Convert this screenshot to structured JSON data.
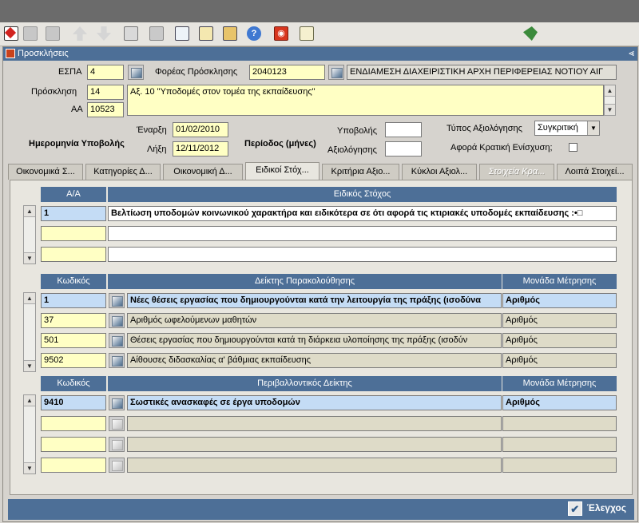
{
  "toolbar": {
    "icons": [
      "check-cursor-icon",
      "grid-icon",
      "grid-icon",
      "up-arrow-icon",
      "down-arrow-icon",
      "print-icon",
      "print-icon",
      "edit-icon",
      "copy-icon",
      "paste-icon",
      "help-icon",
      "exit-icon",
      "document-icon",
      "pin-icon"
    ]
  },
  "window": {
    "title": "Προσκλήσεις",
    "minimize": "⪡"
  },
  "form": {
    "espa_label": "ΕΣΠΑ",
    "espa_value": "4",
    "foreas_label": "Φορέας Πρόσκλησης",
    "foreas_code": "2040123",
    "foreas_name": "ΕΝΔΙΑΜΕΣΗ ΔΙΑΧΕΙΡΙΣΤΙΚΗ ΑΡΧΗ ΠΕΡΙΦΕΡΕΙΑΣ ΝΟΤΙΟΥ ΑΙΓ",
    "prosklisi_label": "Πρόσκληση",
    "prosklisi_value": "14",
    "prosklisi_text": "Αξ. 10 \"Υποδομές στον τομέα της εκπαίδευσης\"",
    "aa_label": "ΑΑ",
    "aa_value": "10523",
    "hmerominia_label": "Ημερομηνία Υποβολής",
    "enarxi_label": "Έναρξη",
    "enarxi_value": "01/02/2010",
    "lixi_label": "Λήξη",
    "lixi_value": "12/11/2012",
    "periodos_label": "Περίοδος (μήνες)",
    "ypovolis_label": "Υποβολής",
    "ypovolis_value": "",
    "axiologisis_label": "Αξιολόγησης",
    "axiologisis_value": "",
    "typos_label": "Τύπος Αξιολόγησης",
    "typos_value": "Συγκριτική",
    "kratiki_label": "Αφορά Κρατική Ενίσχυση;"
  },
  "tabs": [
    {
      "label": "Οικονομικά Σ..."
    },
    {
      "label": "Κατηγορίες Δ..."
    },
    {
      "label": "Οικονομική Δ..."
    },
    {
      "label": "Ειδικοί Στόχ..."
    },
    {
      "label": "Κριτήρια Αξιο..."
    },
    {
      "label": "Κύκλοι Αξιολ..."
    },
    {
      "label": "Στοιχεία Κρα..."
    },
    {
      "label": "Λοιπά Στοιχεί..."
    }
  ],
  "objectives": {
    "col_aa": "Α/Α",
    "col_stoxos": "Ειδικός Στόχος",
    "rows": [
      {
        "aa": "1",
        "text": "Βελτίωση υποδομών κοινωνικού χαρακτήρα και ειδικότερα σε ότι αφορά τις κτιριακές υποδομές εκπαίδευσης :•□"
      },
      {
        "aa": "",
        "text": ""
      },
      {
        "aa": "",
        "text": ""
      }
    ]
  },
  "indicators": {
    "col_code": "Κωδικός",
    "col_name": "Δείκτης Παρακολούθησης",
    "col_unit": "Μονάδα Μέτρησης",
    "rows": [
      {
        "code": "1",
        "name": "Νέες θέσεις εργασίας  που δημιουργούνται κατά την λειτουργία της πράξης (ισοδύνα",
        "unit": "Αριθμός"
      },
      {
        "code": "37",
        "name": "Αριθμός ωφελούμενων μαθητών",
        "unit": "Αριθμός"
      },
      {
        "code": "501",
        "name": "Θέσεις εργασίας που δημιουργούνται κατά τη διάρκεια υλοποίησης της πράξης (ισοδύν",
        "unit": "Αριθμός"
      },
      {
        "code": "9502",
        "name": "Αίθουσες διδασκαλίας α' βάθμιας εκπαίδευσης",
        "unit": "Αριθμός"
      }
    ]
  },
  "environmental": {
    "col_code": "Κωδικός",
    "col_name": "Περιβαλλοντικός Δείκτης",
    "col_unit": "Μονάδα Μέτρησης",
    "rows": [
      {
        "code": "9410",
        "name": "Σωστικές ανασκαφές σε έργα υποδομών",
        "unit": "Αριθμός"
      },
      {
        "code": "",
        "name": "",
        "unit": ""
      },
      {
        "code": "",
        "name": "",
        "unit": ""
      },
      {
        "code": "",
        "name": "",
        "unit": ""
      }
    ]
  },
  "footer": {
    "check_label": "Έλεγχος"
  }
}
